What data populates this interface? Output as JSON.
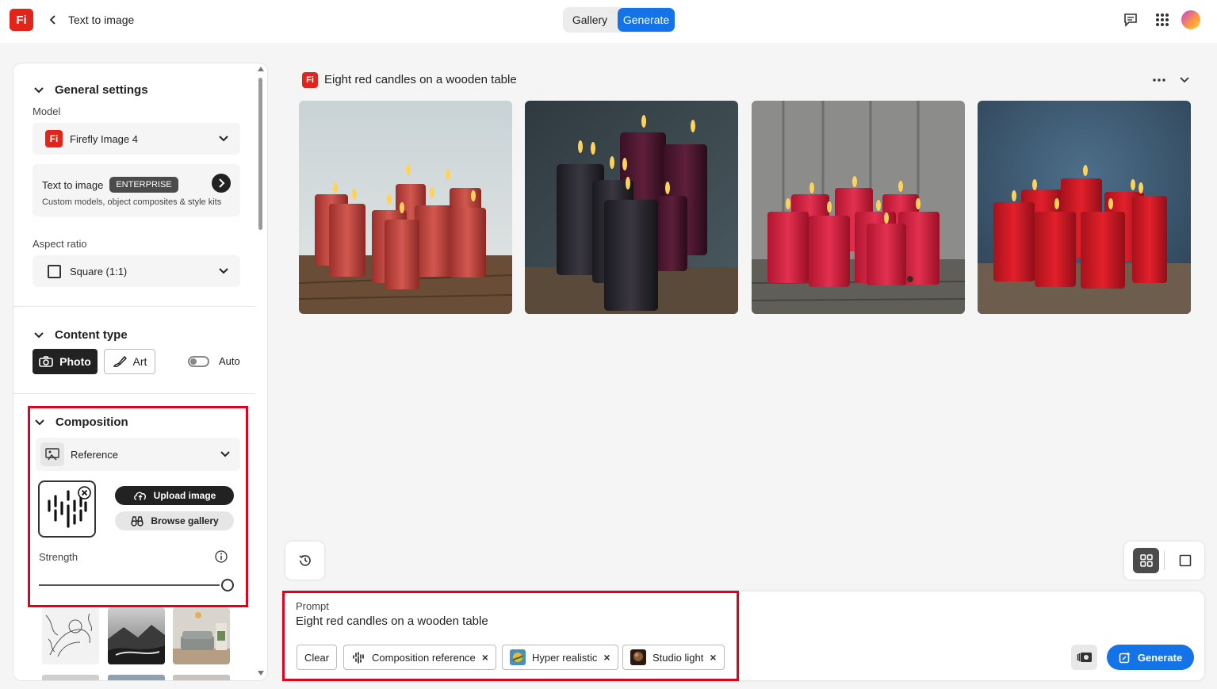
{
  "header": {
    "logo_text": "Fi",
    "title": "Text to image",
    "gallery_label": "Gallery",
    "generate_label": "Generate"
  },
  "general": {
    "title": "General settings",
    "model_label": "Model",
    "model_value": "Firefly Image 4",
    "model_icon_text": "Fi",
    "t2i_title": "Text to image",
    "t2i_badge": "ENTERPRISE",
    "t2i_desc": "Custom models, object composites & style kits",
    "aspect_label": "Aspect ratio",
    "aspect_value": "Square (1:1)"
  },
  "content_type": {
    "title": "Content type",
    "photo_label": "Photo",
    "art_label": "Art",
    "auto_label": "Auto",
    "auto_on": false
  },
  "composition": {
    "title": "Composition",
    "reference_label": "Reference",
    "upload_label": "Upload image",
    "browse_label": "Browse gallery",
    "strength_label": "Strength",
    "strength_value": 1.0
  },
  "main": {
    "logo_text": "Fi",
    "title": "Eight red candles on a wooden table"
  },
  "prompt": {
    "label": "Prompt",
    "text": "Eight red candles on a wooden table",
    "clear_label": "Clear",
    "chips": [
      "Composition reference",
      "Hyper realistic",
      "Studio light"
    ],
    "generate_label": "Generate"
  },
  "colors": {
    "accent": "#1473e6",
    "brand": "#e1251b",
    "highlight": "#e3001b"
  }
}
